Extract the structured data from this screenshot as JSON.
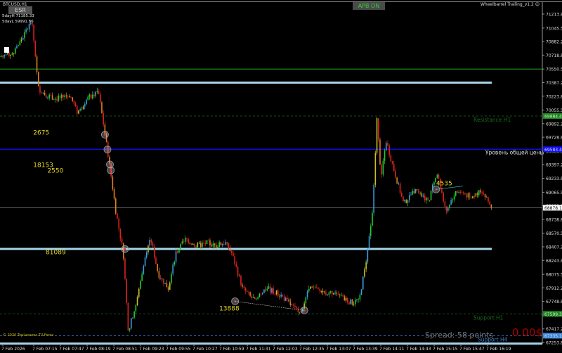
{
  "header": {
    "symbol": "BTCUSD,H1",
    "esr_button": "ESR",
    "day_high": "5dayH 71185.33",
    "day_low": "5dayL 59991.86",
    "apb_button": "APB ON",
    "expert_name": "Wheelbarrel Trailing_v1.2 ☺"
  },
  "footer": {
    "copyright": "© 2020 TopLessons.TV-Forex",
    "spread": "Spread: 58 points",
    "profit": "0.00$"
  },
  "colors": {
    "up": "#22cc33",
    "down": "#e02020",
    "background": "#000000",
    "resistance": "#1a7a1a",
    "support_h4": "#3a7acc",
    "level_blue": "#1010ff",
    "level_lightblue": "#a8d4e8"
  },
  "chart_data": {
    "type": "candlestick",
    "timeframe_label": "BTCUSD,H1",
    "y_ticks": [
      "71213.85",
      "71045.55",
      "70882.20",
      "70718.85",
      "70550.55",
      "70387.20",
      "70223.85",
      "70055.55",
      "69892.20",
      "69728.85",
      "69560.55",
      "69397.20",
      "69233.85",
      "69065.55",
      "68902.20",
      "68738.85",
      "68570.55",
      "68407.20",
      "68243.85",
      "68075.55",
      "67912.20",
      "67748.85",
      "67585.55",
      "67417.20",
      "67253.85"
    ],
    "ylim": [
      67253.85,
      71213.85
    ],
    "x_ticks": [
      "7 Feb 2026",
      "7 Feb 07:15",
      "7 Feb 07:47",
      "7 Feb 08:19",
      "7 Feb 08:51",
      "7 Feb 09:23",
      "7 Feb 09:55",
      "7 Feb 10:27",
      "7 Feb 10:59",
      "7 Feb 11:31",
      "7 Feb 12:03",
      "7 Feb 12:35",
      "7 Feb 13:07",
      "7 Feb 13:39",
      "7 Feb 14:11",
      "7 Feb 14:43",
      "7 Feb 15:15",
      "7 Feb 15:47",
      "7 Feb 16:19"
    ],
    "price_path": [
      [
        "06:31",
        70705
      ],
      [
        "06:48",
        70747
      ],
      [
        "07:09",
        71129
      ],
      [
        "07:13",
        70790
      ],
      [
        "07:17",
        70323
      ],
      [
        "07:26",
        70238
      ],
      [
        "07:39",
        70196
      ],
      [
        "07:55",
        70238
      ],
      [
        "08:04",
        70027
      ],
      [
        "08:16",
        70196
      ],
      [
        "08:29",
        70281
      ],
      [
        "08:37",
        69772
      ],
      [
        "08:42",
        69433
      ],
      [
        "08:50",
        68840
      ],
      [
        "08:59",
        68331
      ],
      [
        "09:05",
        67398
      ],
      [
        "09:15",
        67737
      ],
      [
        "09:24",
        68246
      ],
      [
        "09:32",
        68500
      ],
      [
        "09:41",
        68076
      ],
      [
        "09:53",
        67907
      ],
      [
        "10:02",
        68331
      ],
      [
        "10:14",
        68500
      ],
      [
        "10:27",
        68415
      ],
      [
        "10:40",
        68458
      ],
      [
        "10:48",
        68415
      ],
      [
        "11:01",
        68458
      ],
      [
        "11:09",
        68331
      ],
      [
        "11:22",
        67907
      ],
      [
        "11:34",
        67779
      ],
      [
        "11:51",
        67907
      ],
      [
        "12:08",
        67822
      ],
      [
        "12:25",
        67652
      ],
      [
        "12:33",
        67652
      ],
      [
        "12:42",
        67907
      ],
      [
        "12:59",
        67864
      ],
      [
        "13:15",
        67822
      ],
      [
        "13:32",
        67737
      ],
      [
        "13:41",
        67737
      ],
      [
        "13:49",
        68161
      ],
      [
        "13:58",
        68840
      ],
      [
        "14:03",
        69942
      ],
      [
        "14:08",
        69263
      ],
      [
        "14:14",
        69687
      ],
      [
        "14:23",
        69348
      ],
      [
        "14:35",
        68924
      ],
      [
        "14:48",
        69093
      ],
      [
        "15:05",
        68966
      ],
      [
        "15:15",
        69306
      ],
      [
        "15:26",
        68840
      ],
      [
        "15:38",
        69093
      ],
      [
        "15:55",
        69008
      ],
      [
        "16:08",
        69093
      ],
      [
        "16:21",
        68878
      ]
    ],
    "price_tags": [
      {
        "value": "69984.45",
        "color": "#1a8a1a"
      },
      {
        "value": "69583.45",
        "color": "#1010ff"
      },
      {
        "value": "68878.15",
        "color": "#ffffff"
      },
      {
        "value": "67599.35",
        "color": "#1a8a1a"
      },
      {
        "value": "67335.14",
        "color": "#3a8ae0"
      }
    ],
    "levels": [
      {
        "price": 70550.55,
        "style": "solid",
        "color": "#1a8a1a",
        "label": ""
      },
      {
        "price": 70387.2,
        "style": "thick",
        "color": "#a8d4e8",
        "label": ""
      },
      {
        "price": 69984.45,
        "style": "dashed",
        "color": "#1a6a1a",
        "label": "Resistance H1"
      },
      {
        "price": 69583.45,
        "style": "solid",
        "color": "#1010ff",
        "label": "Уровень общей цены"
      },
      {
        "price": 68878.15,
        "style": "solid",
        "color": "#555555",
        "label": ""
      },
      {
        "price": 68382.0,
        "style": "thick",
        "color": "#a8d4e8",
        "label": ""
      },
      {
        "price": 67599.35,
        "style": "dashed",
        "color": "#1a6a1a",
        "label": "Support H1"
      },
      {
        "price": 67335.14,
        "style": "dashed",
        "color": "#3a7acc",
        "label": "Support H4"
      },
      {
        "price": 67240.0,
        "style": "thick",
        "color": "#a8d4e8",
        "label": ""
      }
    ],
    "annotations": [
      {
        "text": "2675",
        "time": "07:11",
        "price": 69760
      },
      {
        "text": "18153",
        "time": "07:11",
        "price": 69370
      },
      {
        "text": "2550",
        "time": "07:28",
        "price": 69300
      },
      {
        "text": "81089",
        "time": "07:26",
        "price": 68320
      },
      {
        "text": "13888",
        "time": "10:54",
        "price": 67640
      },
      {
        "text": "4535",
        "time": "15:14",
        "price": 69150
      }
    ]
  }
}
